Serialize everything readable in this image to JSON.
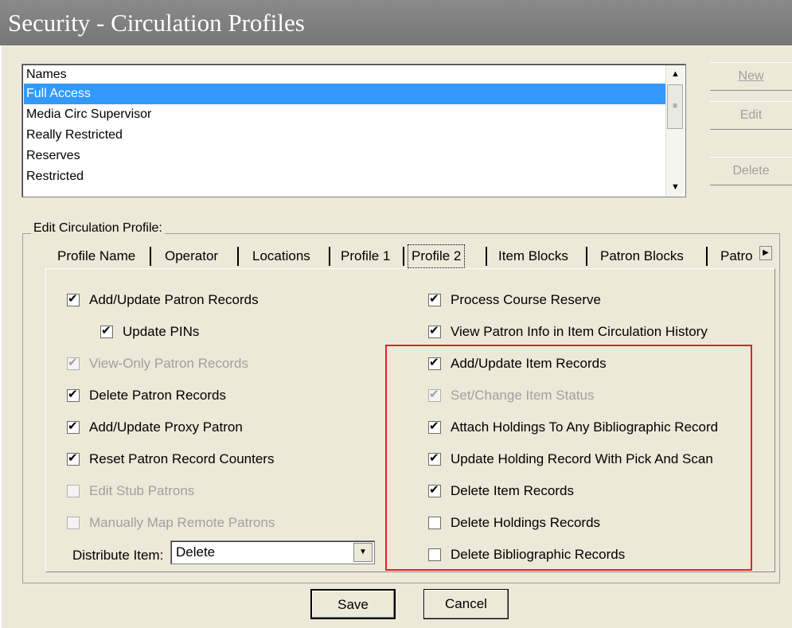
{
  "window": {
    "title": "Security - Circulation Profiles"
  },
  "names_list": {
    "header": "Names",
    "items": [
      "Full Access",
      "Media Circ Supervisor",
      "Really Restricted",
      "Reserves",
      "Restricted"
    ],
    "selected": "Full Access"
  },
  "side_buttons": {
    "new": "New",
    "edit": "Edit",
    "delete": "Delete"
  },
  "edit_group": {
    "label": "Edit Circulation Profile:"
  },
  "tabs": [
    "Profile Name",
    "Operator",
    "Locations",
    "Profile 1",
    "Profile 2",
    "Item Blocks",
    "Patron Blocks",
    "Patro"
  ],
  "active_tab": "Profile 2",
  "left_options": [
    {
      "label": "Add/Update Patron Records",
      "checked": true,
      "disabled": false
    },
    {
      "label": "Update PINs",
      "checked": true,
      "disabled": false
    },
    {
      "label": "View-Only Patron Records",
      "checked": true,
      "disabled": true
    },
    {
      "label": "Delete Patron Records",
      "checked": true,
      "disabled": false
    },
    {
      "label": "Add/Update Proxy Patron",
      "checked": true,
      "disabled": false
    },
    {
      "label": "Reset Patron Record Counters",
      "checked": true,
      "disabled": false
    },
    {
      "label": "Edit Stub Patrons",
      "checked": false,
      "disabled": true
    },
    {
      "label": "Manually Map Remote Patrons",
      "checked": false,
      "disabled": true
    }
  ],
  "right_options": [
    {
      "label": "Process Course Reserve",
      "checked": true,
      "disabled": false
    },
    {
      "label": "View Patron Info in Item Circulation History",
      "checked": true,
      "disabled": false
    },
    {
      "label": "Add/Update Item Records",
      "checked": true,
      "disabled": false
    },
    {
      "label": "Set/Change Item Status",
      "checked": true,
      "disabled": true
    },
    {
      "label": "Attach Holdings To Any Bibliographic Record",
      "checked": true,
      "disabled": false
    },
    {
      "label": "Update Holding Record With Pick And Scan",
      "checked": true,
      "disabled": false
    },
    {
      "label": "Delete Item Records",
      "checked": true,
      "disabled": false
    },
    {
      "label": "Delete Holdings Records",
      "checked": false,
      "disabled": false
    },
    {
      "label": "Delete Bibliographic Records",
      "checked": false,
      "disabled": false
    }
  ],
  "distribute_item": {
    "label": "Distribute Item:",
    "value": "Delete"
  },
  "footer_buttons": {
    "save": "Save",
    "cancel": "Cancel"
  },
  "icons": {
    "scroll_up": "chevron-up-icon",
    "scroll_down": "chevron-down-icon",
    "combo_drop": "chevron-down-icon",
    "tab_scroll": "chevron-right-icon",
    "checkmark": "check-icon"
  },
  "colors": {
    "selection": "#3399ff",
    "highlight_box": "#e0222a",
    "title_bg": "#808080"
  }
}
